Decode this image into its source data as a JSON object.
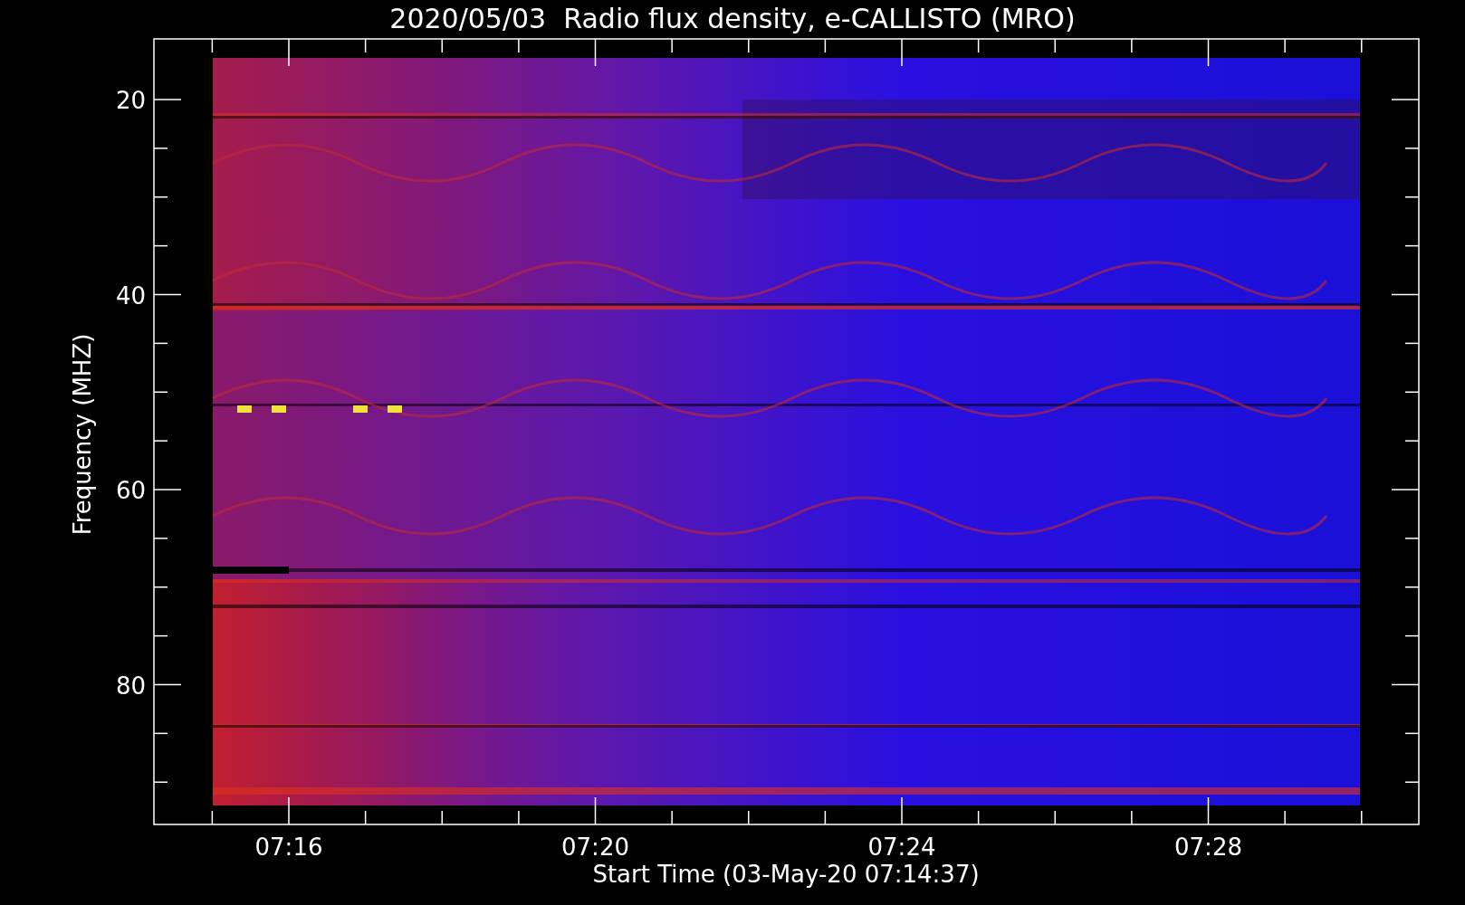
{
  "title": "2020/05/03  Radio flux density, e-CALLISTO (MRO)",
  "plot": {
    "ylabel": "Frequency (MHZ)",
    "xlabel": "Start Time (03-May-20 07:14:37)",
    "yticks": [
      "20",
      "40",
      "60",
      "80"
    ],
    "xticks": [
      "07:16",
      "07:20",
      "07:24",
      "07:28"
    ]
  }
}
